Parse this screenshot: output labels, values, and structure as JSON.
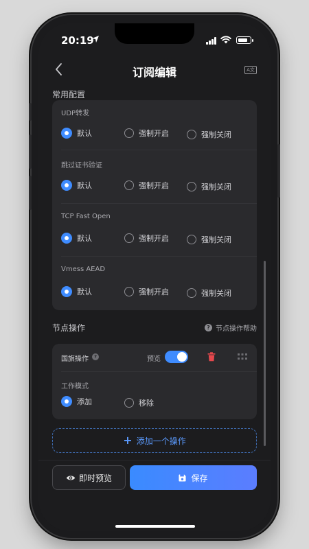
{
  "status": {
    "time": "20:19"
  },
  "nav": {
    "title": "订阅编辑"
  },
  "common_config": {
    "heading": "常用配置",
    "groups": [
      {
        "label": "UDP转发",
        "options": [
          "默认",
          "强制开启",
          "强制关闭"
        ],
        "selected": 0
      },
      {
        "label": "跳过证书验证",
        "options": [
          "默认",
          "强制开启",
          "强制关闭"
        ],
        "selected": 0
      },
      {
        "label": "TCP Fast Open",
        "options": [
          "默认",
          "强制开启",
          "强制关闭"
        ],
        "selected": 0
      },
      {
        "label": "Vmess AEAD",
        "options": [
          "默认",
          "强制开启",
          "强制关闭"
        ],
        "selected": 0
      }
    ]
  },
  "node_ops": {
    "heading": "节点操作",
    "help_label": "节点操作帮助",
    "operation": {
      "name": "国旗操作",
      "preview_label": "预览",
      "preview_on": true,
      "mode_label": "工作模式",
      "modes": [
        "添加",
        "移除"
      ],
      "selected": 0
    },
    "add_label": "添加一个操作"
  },
  "bottom": {
    "preview_label": "即时预览",
    "save_label": "保存"
  },
  "colors": {
    "accent": "#3f8cff",
    "danger": "#e5484d",
    "background": "#1c1c1e",
    "card": "#2a2a2d"
  }
}
